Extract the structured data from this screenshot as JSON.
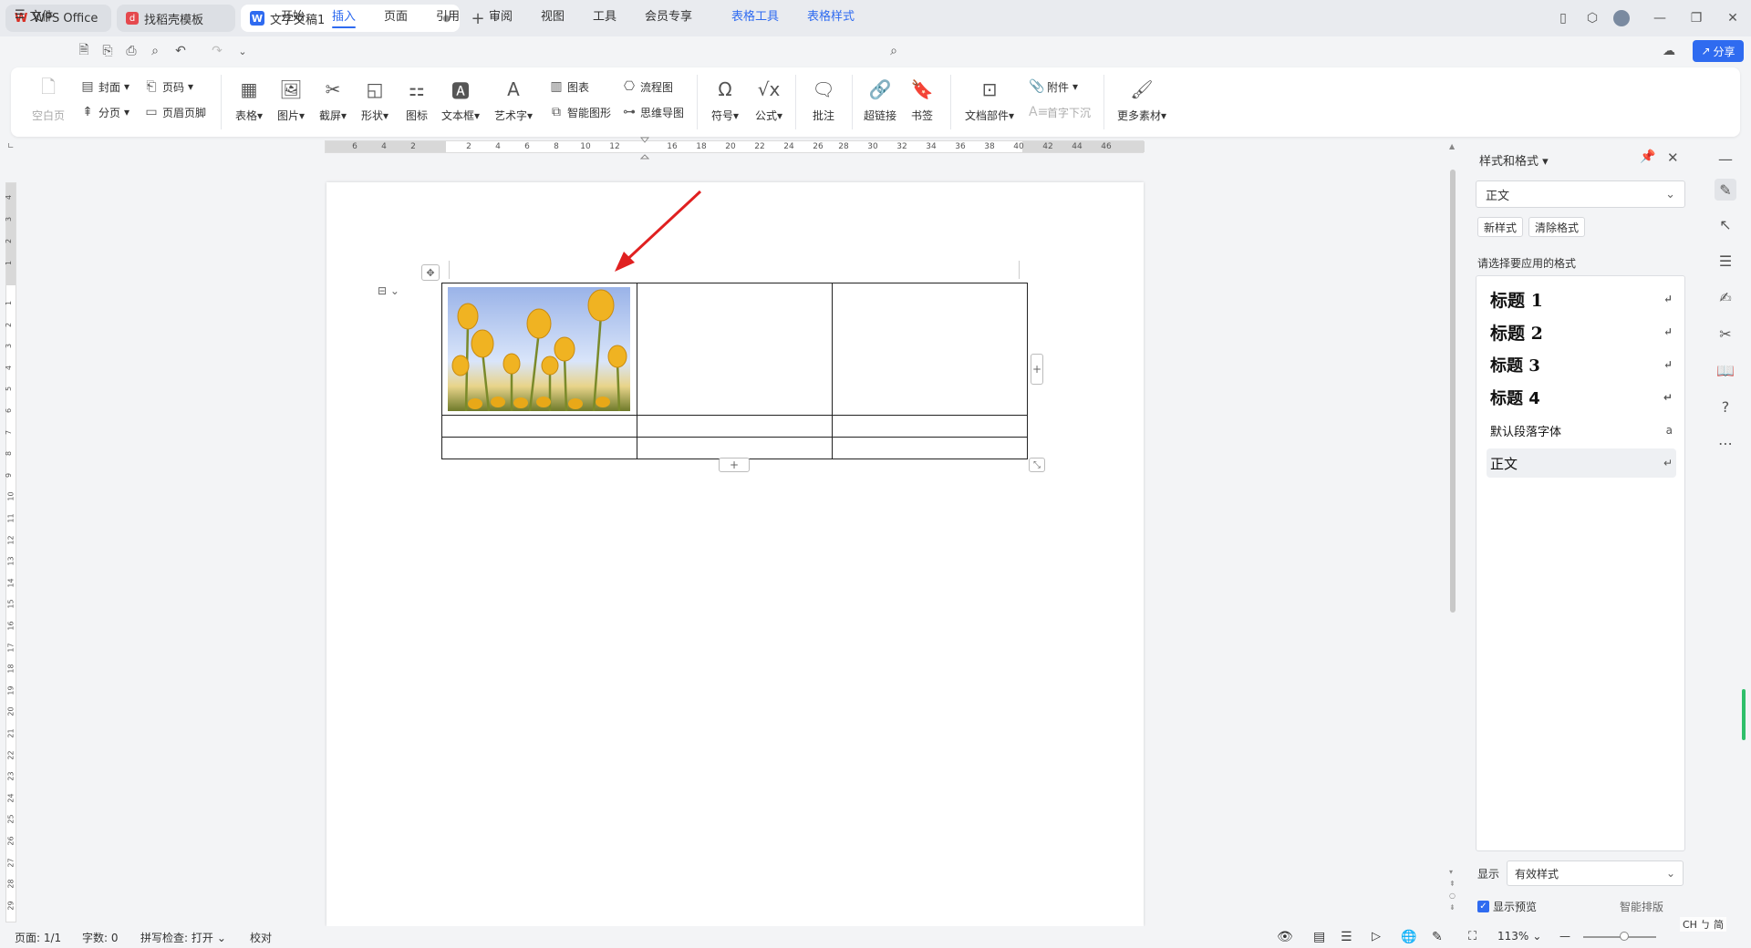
{
  "tabs": [
    {
      "label": "WPS Office",
      "icon": "wps-logo-icon"
    },
    {
      "label": "找稻壳模板",
      "icon": "docer-logo-icon"
    },
    {
      "label": "文字文稿1",
      "icon": "writer-doc-icon",
      "modified_dot": "●"
    }
  ],
  "menu": {
    "file": "文件",
    "items": [
      "开始",
      "插入",
      "页面",
      "引用",
      "审阅",
      "视图",
      "工具",
      "会员专享"
    ],
    "active": "插入",
    "context_items": [
      "表格工具",
      "表格样式"
    ],
    "share": "分享"
  },
  "ribbon": {
    "blank_page": "空白页",
    "cover": "封面",
    "page_number": "页码",
    "page_break": "分页",
    "header_footer": "页眉页脚",
    "table": "表格",
    "picture": "图片",
    "screenshot": "截屏",
    "shape": "形状",
    "icon": "图标",
    "textbox": "文本框",
    "wordart": "艺术字",
    "chart": "图表",
    "smart_shape": "智能图形",
    "flowchart": "流程图",
    "mindmap": "思维导图",
    "symbol": "符号",
    "formula": "公式",
    "comment": "批注",
    "hyperlink": "超链接",
    "bookmark": "书签",
    "doc_parts": "文档部件",
    "attachment": "附件",
    "dropcap": "首字下沉",
    "more_materials": "更多素材"
  },
  "ruler": {
    "h_ticks": [
      "6",
      "4",
      "2",
      "2",
      "4",
      "6",
      "8",
      "10",
      "12",
      "16",
      "18",
      "20",
      "22",
      "24",
      "26",
      "28",
      "30",
      "32",
      "34",
      "36",
      "38",
      "40",
      "42",
      "44",
      "46"
    ],
    "v_ticks": [
      "4",
      "3",
      "2",
      "1",
      "1",
      "2",
      "3",
      "4",
      "5",
      "6",
      "7",
      "8",
      "9",
      "10",
      "11",
      "12",
      "13",
      "14",
      "15",
      "16",
      "17",
      "18",
      "19",
      "20",
      "21",
      "22",
      "23",
      "24",
      "25",
      "26",
      "27",
      "28",
      "29"
    ]
  },
  "panel": {
    "title": "样式和格式",
    "current_style": "正文",
    "new_style": "新样式",
    "clear_format": "清除格式",
    "choose_label": "请选择要应用的格式",
    "styles": [
      {
        "label": "标题 1",
        "mark": "↵"
      },
      {
        "label": "标题 2",
        "mark": "↵"
      },
      {
        "label": "标题 3",
        "mark": "↵"
      },
      {
        "label": "标题 4",
        "mark": "↵"
      },
      {
        "label": "默认段落字体",
        "mark": "a"
      },
      {
        "label": "正文",
        "mark": "↵"
      }
    ],
    "show_label": "显示",
    "show_value": "有效样式",
    "preview_label": "显示预览",
    "smart_layout": "智能排版"
  },
  "status": {
    "page": "页面: 1/1",
    "words": "字数: 0",
    "spell": "拼写检查: 打开",
    "proof": "校对",
    "zoom": "113%",
    "ime": "CH ㄅ 简"
  },
  "colors": {
    "accent": "#2f6bf0",
    "arrow": "#e02020"
  }
}
